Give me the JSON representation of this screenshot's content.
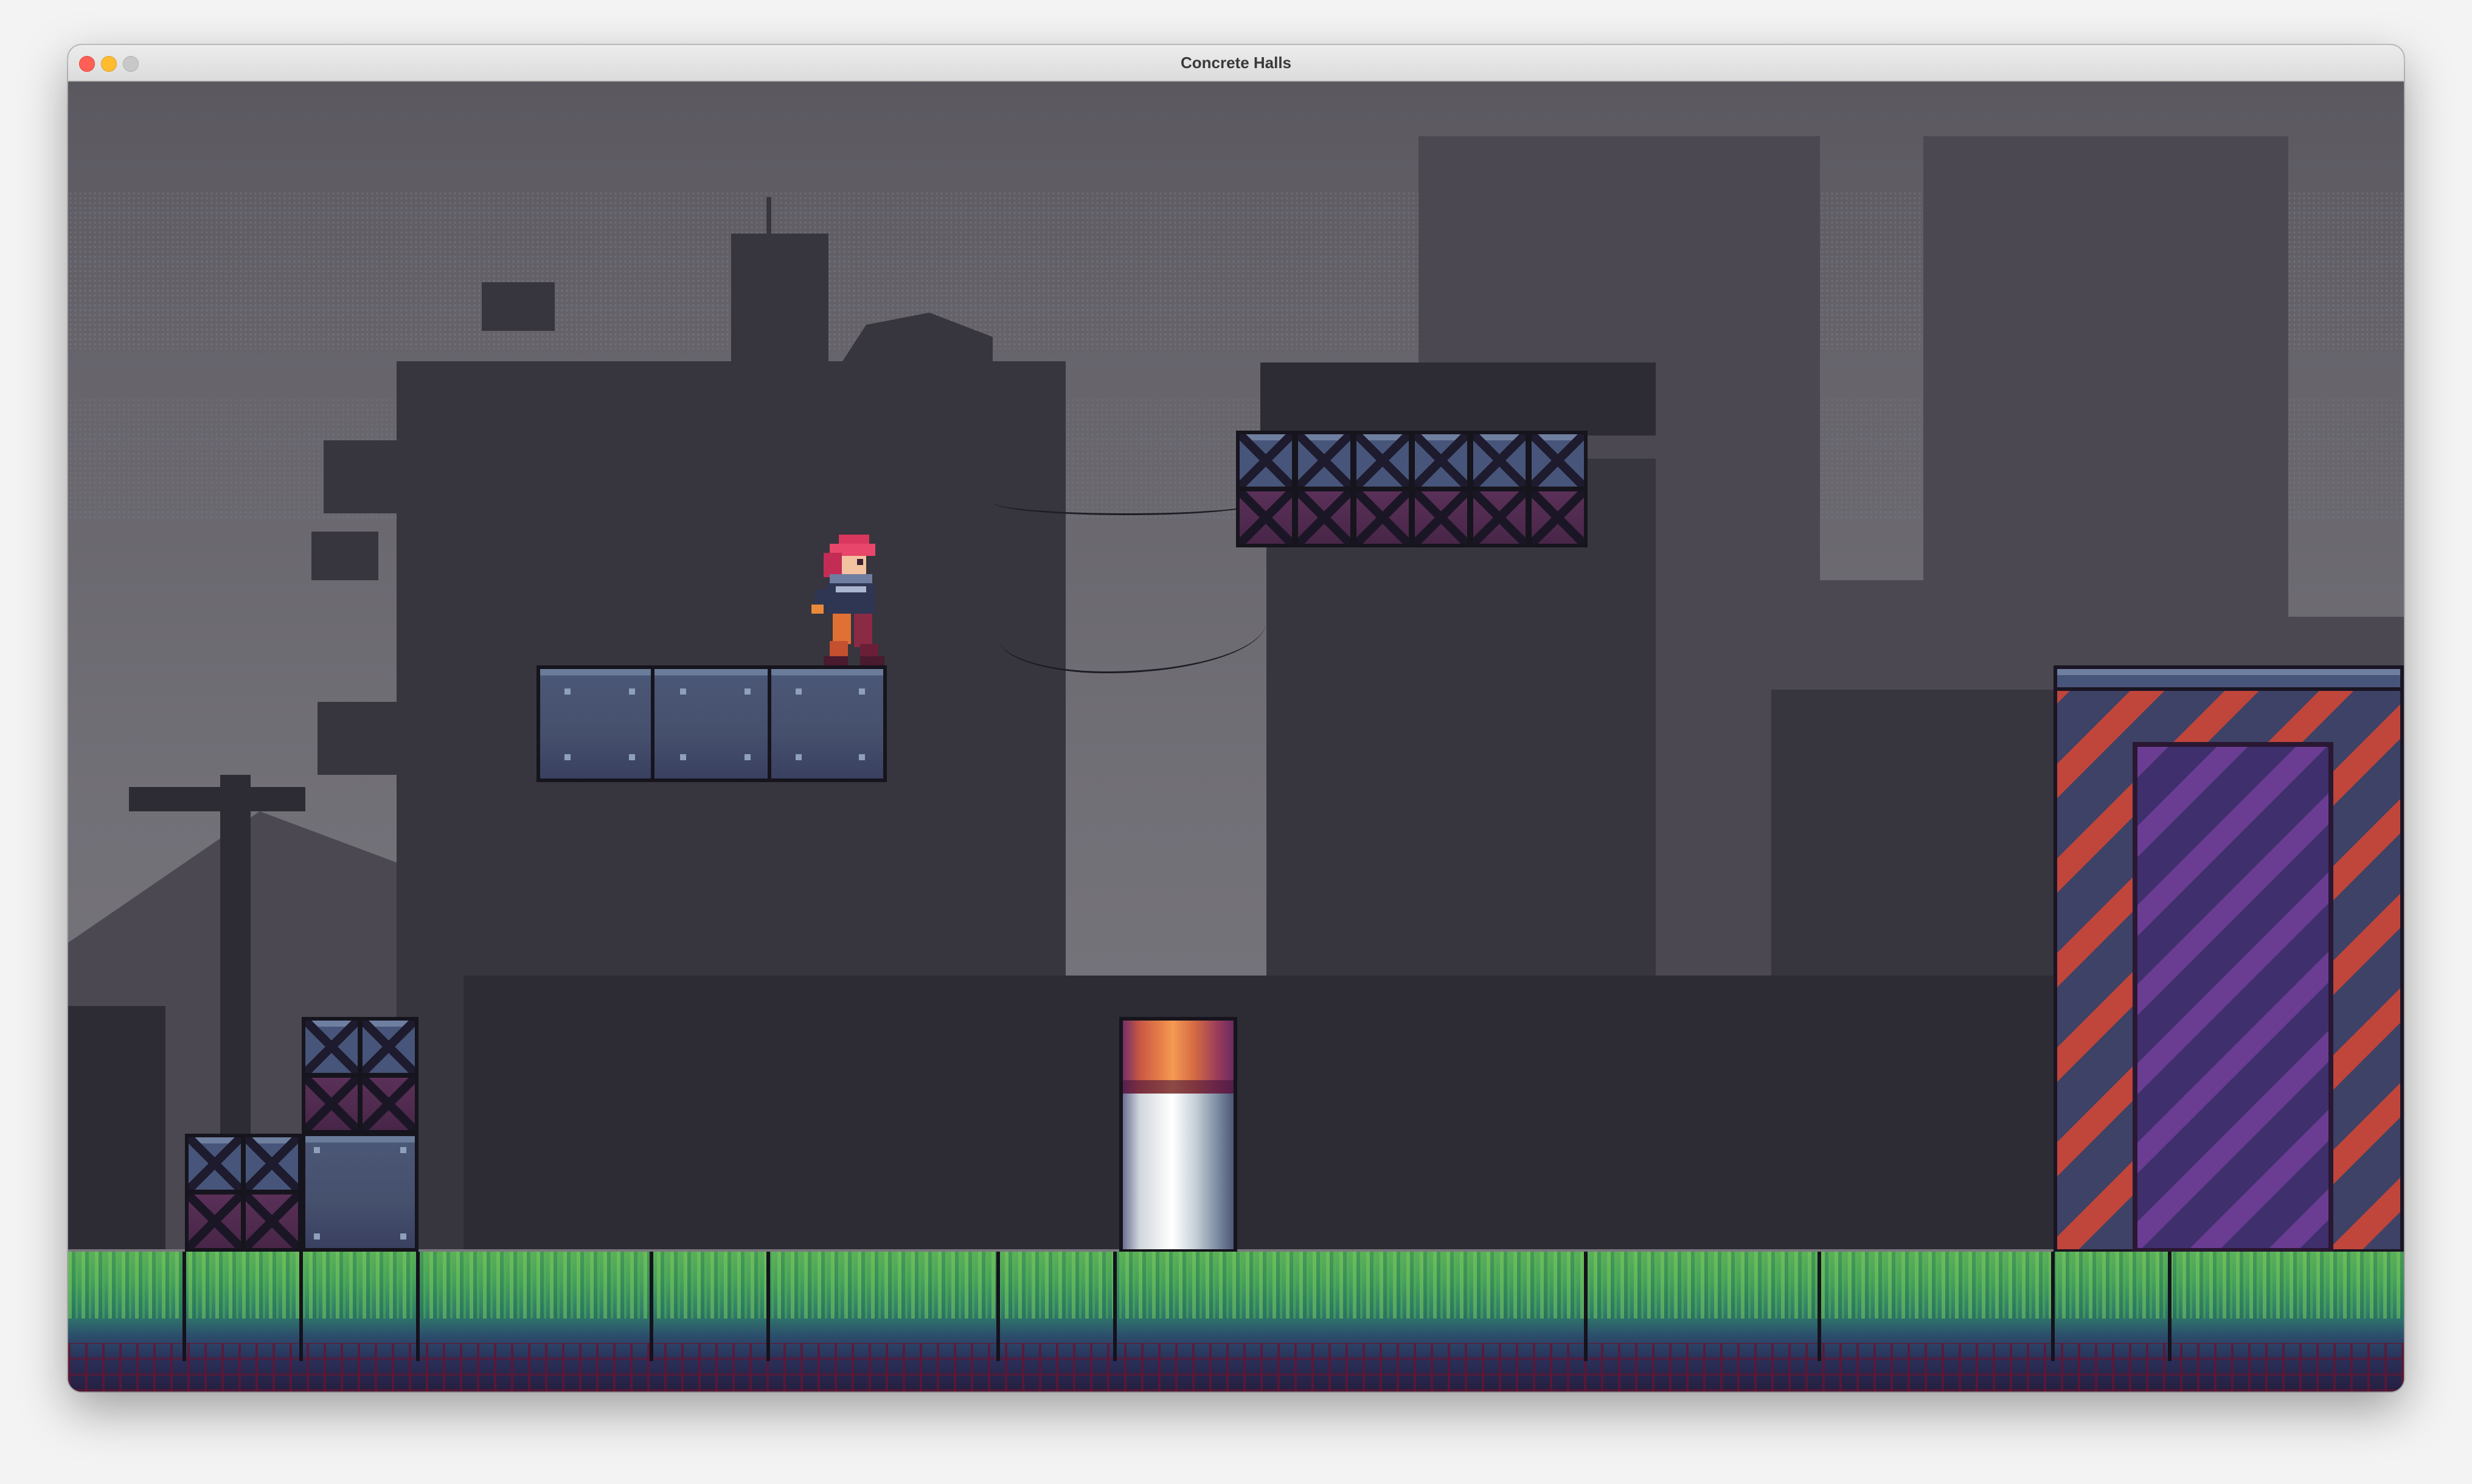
{
  "window": {
    "title": "Concrete Halls"
  },
  "game": {
    "scene": "industrial-rooftops",
    "palette": {
      "sky": "#5b5860",
      "far_buildings": "#4b4851",
      "mid_buildings": "#37353d",
      "near_silhouettes": "#2d2b33",
      "steel_block": "#48557a",
      "grass": "#5cb05a",
      "hazard_red": "#c0453a",
      "hazard_purple": "#6a3d92",
      "pillar_orange": "#e88149"
    },
    "entities": {
      "player": "red-haired-character",
      "platforms": [
        "steel-platform",
        "x-crate-platform"
      ],
      "obstacles": [
        "crate-stack-small",
        "crate-stack-tall",
        "striped-pillar",
        "hazard-wall"
      ]
    }
  }
}
